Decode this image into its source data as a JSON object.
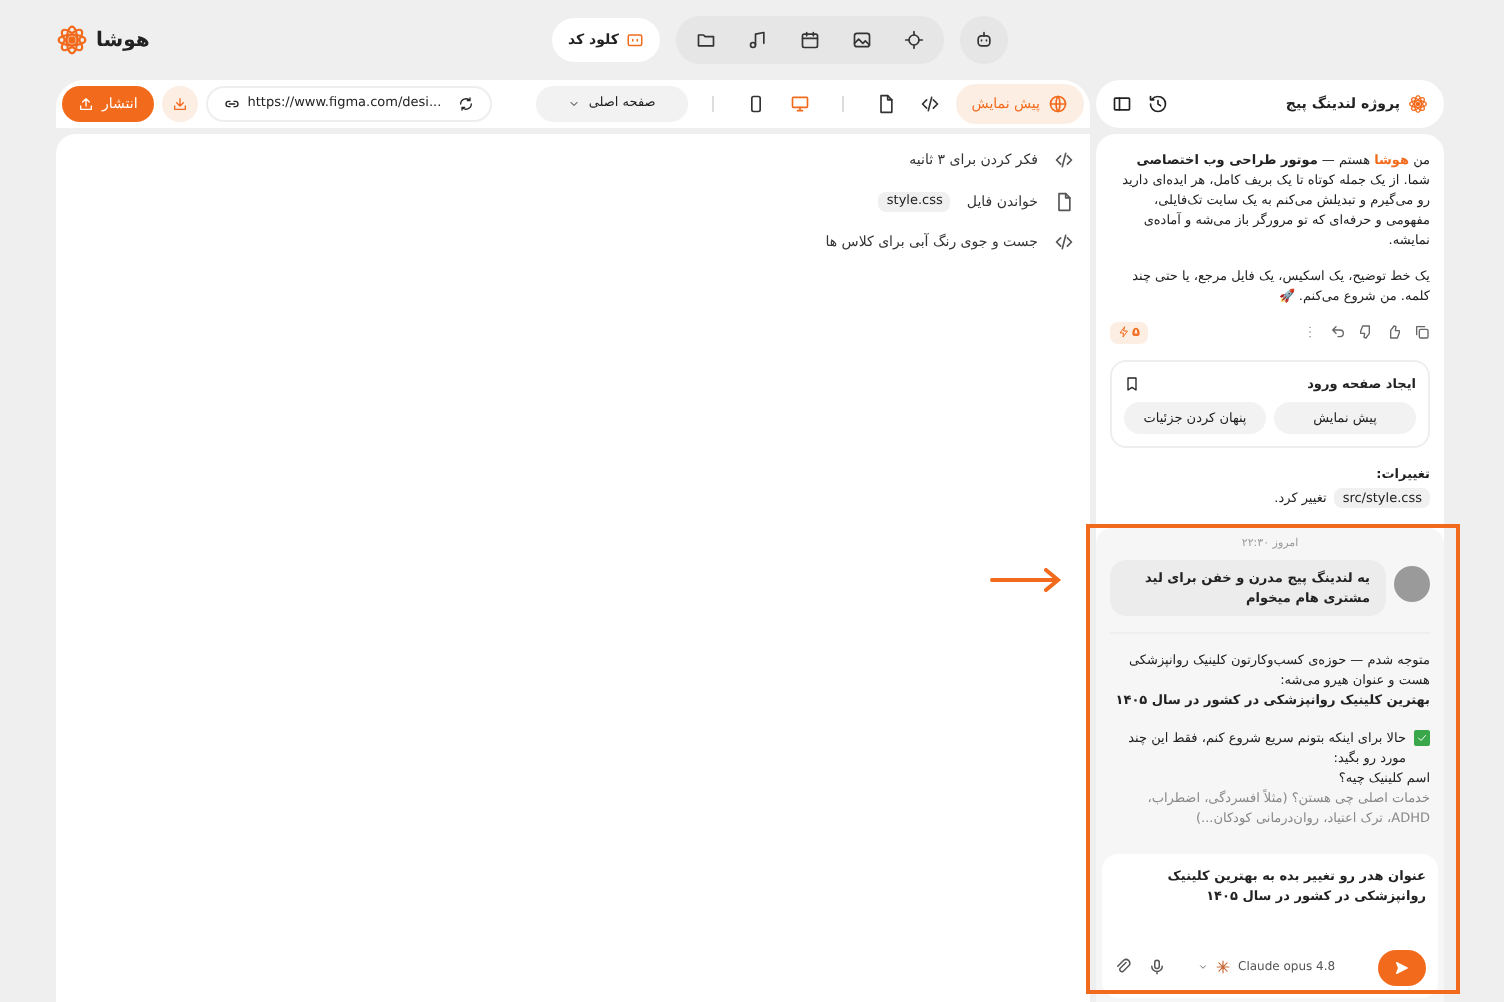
{
  "app": {
    "name": "هوشا"
  },
  "top_bar": {
    "claude_code": "کلود کد"
  },
  "toolbar": {
    "publish": "انتشار",
    "url": "https://www.figma.com/desi...",
    "page_select": "صفحه اصلی",
    "devices": [
      {
        "kind": "mobile",
        "selected": false
      },
      {
        "kind": "desktop",
        "selected": true
      }
    ],
    "view_tabs": [
      {
        "kind": "file",
        "selected": false
      },
      {
        "kind": "code",
        "selected": false
      },
      {
        "kind": "preview",
        "label": "پیش نمایش",
        "selected": true
      }
    ]
  },
  "steps": [
    {
      "kind": "code",
      "text": "فکر کردن برای ۳ ثانیه"
    },
    {
      "kind": "file",
      "text": "خواندن فایل",
      "file": "style.css"
    },
    {
      "kind": "code",
      "text": "جست و جوی رنگ آبی برای کلاس ها"
    }
  ],
  "project": {
    "title": "پروژه لندینگ پیج"
  },
  "chat": {
    "intro": [
      "من **هوشا** هستم — **موتور طراحی وب اختصاصی** شما. از یک جمله کوتاه تا یک بریف کامل، هر ایده‌ای دارید رو می‌گیرم و تبدیلش می‌کنم به یک سایت تک‌فایلی، مفهومی و حرفه‌ای که تو مرورگر باز می‌شه و آماده‌ی نمایشه.",
      "یک خط توضیح، یک اسکیس، یک فایل مرجع، یا حتی چند کلمه. من شروع می‌کنم. 🚀"
    ],
    "credits": "۵",
    "card": {
      "title": "ایجاد صفحه ورود",
      "buttons": [
        "پیش نمایش",
        "پنهان کردن جزئیات"
      ]
    },
    "changes": {
      "title": "تغییرات:",
      "file": "src/style.css",
      "text": "تغییر کرد."
    },
    "timestamp": "امروز ۲۲:۳۰",
    "user_message": "یه لندینگ پیج مدرن و خفن برای لید مشتری هام میخوام",
    "reply": [
      {
        "kind": "text",
        "text": "متوجه شدم — حوزه‌ی کسب‌وکارتون کلینیک روانپزشکی هست و عنوان هیرو می‌شه:"
      },
      {
        "kind": "bold",
        "text": "بهترین کلینیک روانپزشکی در کشور در سال ۱۴۰۵"
      },
      {
        "kind": "check",
        "text": "حالا برای اینکه بتونم سریع شروع کنم، فقط این چند مورد رو بگید:"
      },
      {
        "kind": "text",
        "text": "اسم کلینیک چیه؟"
      },
      {
        "kind": "faded",
        "text": "خدمات اصلی چی هستن؟ (مثلاً افسردگی، اضطراب، ADHD، ترک اعتیاد، روان‌درمانی کودکان...)"
      }
    ],
    "input": "عنوان هدر رو تغییر بده به بهترین کلینیک روانپزشکی در کشور در سال ۱۴۰۵",
    "model": "Claude opus 4.8"
  },
  "annotation": {
    "kind": "highlight"
  }
}
